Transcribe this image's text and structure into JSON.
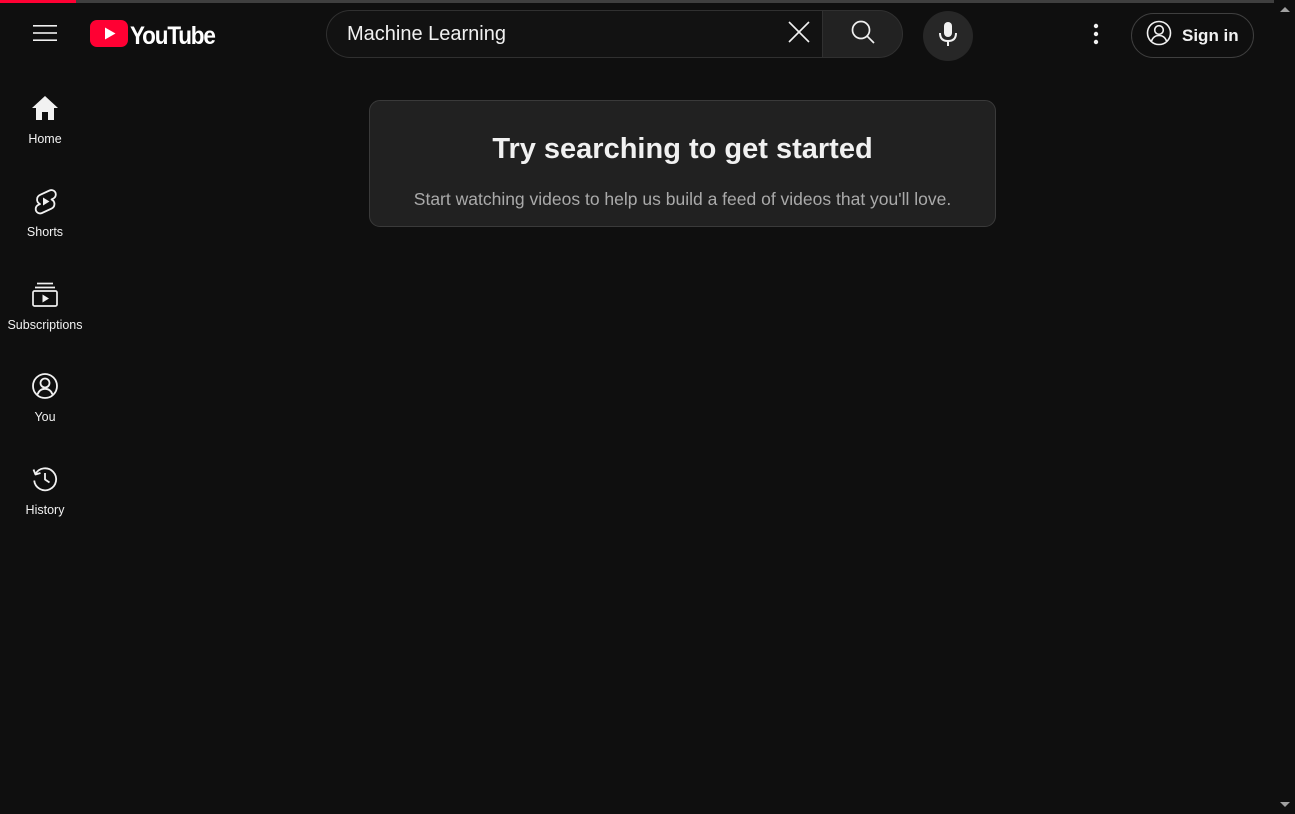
{
  "progress": {
    "fraction": 0.06,
    "color": "#ff0033"
  },
  "header": {
    "logo_text": "YouTube",
    "logo_color": "#ff0033",
    "search": {
      "value": "Machine Learning",
      "placeholder": "Search"
    },
    "signin_label": "Sign in",
    "icons": {
      "menu": "hamburger-menu-icon",
      "clear": "close-icon",
      "search": "search-icon",
      "mic": "microphone-icon",
      "more": "more-vertical-icon",
      "account": "account-circle-icon"
    }
  },
  "sidebar": {
    "items": [
      {
        "label": "Home",
        "icon": "home-icon"
      },
      {
        "label": "Shorts",
        "icon": "shorts-icon"
      },
      {
        "label": "Subscriptions",
        "icon": "subscriptions-icon"
      },
      {
        "label": "You",
        "icon": "you-icon"
      },
      {
        "label": "History",
        "icon": "history-icon"
      }
    ]
  },
  "main": {
    "prompt_card": {
      "title": "Try searching to get started",
      "subtitle": "Start watching videos to help us build a feed of videos that you'll love."
    }
  },
  "colors": {
    "background": "#0f0f0f",
    "card_background": "#212121",
    "text_primary": "#f1f1f1",
    "text_secondary": "#aaaaaa"
  }
}
